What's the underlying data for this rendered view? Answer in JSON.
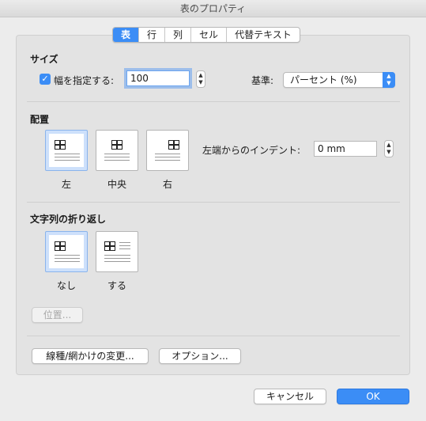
{
  "window": {
    "title": "表のプロパティ"
  },
  "tabs": [
    {
      "label": "表",
      "active": true
    },
    {
      "label": "行",
      "active": false
    },
    {
      "label": "列",
      "active": false
    },
    {
      "label": "セル",
      "active": false
    },
    {
      "label": "代替テキスト",
      "active": false
    }
  ],
  "size": {
    "heading": "サイズ",
    "width_checkbox_label": "幅を指定する:",
    "width_checked": true,
    "width_value": "100",
    "basis_label": "基準:",
    "basis_selected": "パーセント (%)"
  },
  "alignment": {
    "heading": "配置",
    "options": [
      {
        "label": "左",
        "selected": true
      },
      {
        "label": "中央",
        "selected": false
      },
      {
        "label": "右",
        "selected": false
      }
    ],
    "indent_label": "左端からのインデント:",
    "indent_value": "0 mm"
  },
  "wrapping": {
    "heading": "文字列の折り返し",
    "options": [
      {
        "label": "なし",
        "selected": true
      },
      {
        "label": "する",
        "selected": false
      }
    ],
    "position_button": "位置..."
  },
  "bottom_buttons": {
    "borders": "線種/網かけの変更...",
    "options": "オプション..."
  },
  "dialog_buttons": {
    "cancel": "キャンセル",
    "ok": "OK"
  },
  "colors": {
    "accent": "#3b8df6",
    "selected_option": "#cde0fb"
  }
}
